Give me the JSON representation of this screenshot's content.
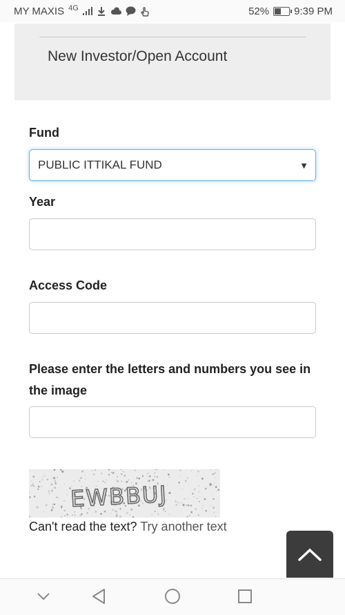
{
  "status_bar": {
    "carrier": "MY MAXIS",
    "network": "4G",
    "battery": "52%",
    "battery_level": 0.52,
    "time": "9:39 PM"
  },
  "panel": {
    "title": "New Investor/Open Account"
  },
  "form": {
    "fund_label": "Fund",
    "fund_value": "PUBLIC ITTIKAL FUND",
    "year_label": "Year",
    "year_value": "",
    "access_code_label": "Access Code",
    "access_code_value": "",
    "captcha_label": "Please enter the letters and numbers you see in the image",
    "captcha_value": ""
  },
  "captcha": {
    "image_text": "EWBBUJ",
    "help_text": "Can't read the text?",
    "retry_link": "Try another text"
  },
  "icons": {
    "scroll_top": "chevron-up-icon",
    "nav": [
      "chevron-down-icon",
      "back-icon",
      "home-icon",
      "recents-icon"
    ]
  }
}
